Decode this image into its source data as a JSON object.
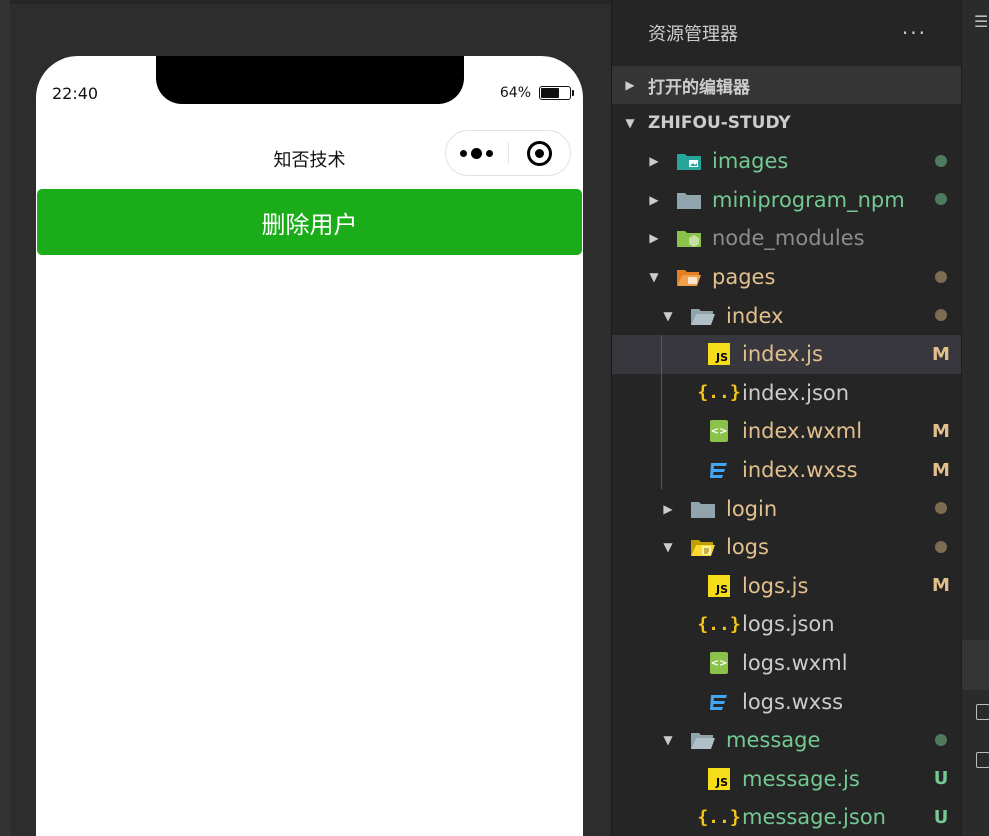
{
  "simulator": {
    "status_time": "22:40",
    "battery_percent": "64%",
    "battery_level": 0.64,
    "nav_title": "知否技术",
    "delete_button_label": "删除用户",
    "button_color": "#1aad19"
  },
  "explorer": {
    "title": "资源管理器",
    "more": "···",
    "open_editors": "打开的编辑器",
    "project": "ZHIFOU-STUDY",
    "colors": {
      "untracked": "#73c991",
      "modified": "#e2c08d",
      "ignored": "#8c8c8c",
      "plain": "#cccccc"
    },
    "items": [
      {
        "label": "images",
        "badge": "",
        "dot": "#5a8a6a"
      },
      {
        "label": "miniprogram_npm",
        "badge": "",
        "dot": "#5a8a6a"
      },
      {
        "label": "node_modules",
        "badge": "",
        "dot": ""
      },
      {
        "label": "pages",
        "badge": "",
        "dot": "#8a7a5a"
      },
      {
        "label": "index",
        "badge": "",
        "dot": "#8a7a5a"
      },
      {
        "label": "index.js",
        "badge": "M"
      },
      {
        "label": "index.json",
        "badge": ""
      },
      {
        "label": "index.wxml",
        "badge": "M"
      },
      {
        "label": "index.wxss",
        "badge": "M"
      },
      {
        "label": "login",
        "badge": "",
        "dot": "#8a7a5a"
      },
      {
        "label": "logs",
        "badge": "",
        "dot": "#8a7a5a"
      },
      {
        "label": "logs.js",
        "badge": "M"
      },
      {
        "label": "logs.json",
        "badge": ""
      },
      {
        "label": "logs.wxml",
        "badge": ""
      },
      {
        "label": "logs.wxss",
        "badge": ""
      },
      {
        "label": "message",
        "badge": "",
        "dot": "#5a8a6a"
      },
      {
        "label": "message.js",
        "badge": "U"
      },
      {
        "label": "message.json",
        "badge": "U"
      }
    ]
  }
}
